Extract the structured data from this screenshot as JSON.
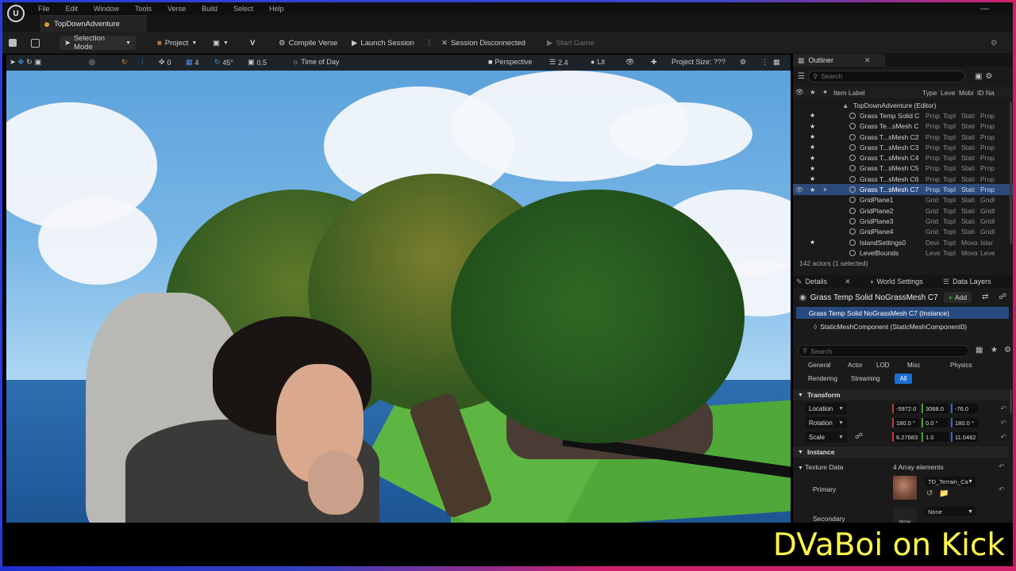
{
  "window": {
    "menu": [
      "File",
      "Edit",
      "Window",
      "Tools",
      "Verse",
      "Build",
      "Select",
      "Help"
    ],
    "project_tab": "TopDownAdventure"
  },
  "toolbar": {
    "selection_mode": "Selection Mode",
    "project": "Project",
    "compile_verse": "Compile Verse",
    "launch_session": "Launch Session",
    "session_status": "Session Disconnected",
    "start_game": "Start Game"
  },
  "viewport": {
    "snap_value": "0",
    "grid_value": "4",
    "angle_value": "45°",
    "scale_value": "0.5",
    "time_of_day": "Time of Day",
    "perspective": "Perspective",
    "camera_speed": "2.4",
    "lit": "Lit",
    "project_size": "Project Size: ???"
  },
  "outliner": {
    "tab_label": "Outliner",
    "search_placeholder": "Search",
    "columns": {
      "label": "Item Label",
      "type": "Type",
      "level": "Leve",
      "mobility": "Mobi",
      "id": "ID Na"
    },
    "root": "TopDownAdventure (Editor)",
    "rows": [
      {
        "label": "Grass Temp Solid C",
        "type": "Prop",
        "level": "TopI",
        "mobility": "Stati",
        "id": "Prop",
        "star": true,
        "selected": false
      },
      {
        "label": "Grass Te...sMesh C",
        "type": "Prop",
        "level": "TopI",
        "mobility": "Stati",
        "id": "Prop",
        "star": true,
        "selected": false
      },
      {
        "label": "Grass T...sMesh C2",
        "type": "Prop",
        "level": "TopI",
        "mobility": "Stati",
        "id": "Prop",
        "star": true,
        "selected": false
      },
      {
        "label": "Grass T...sMesh C3",
        "type": "Prop",
        "level": "TopI",
        "mobility": "Stati",
        "id": "Prop",
        "star": true,
        "selected": false
      },
      {
        "label": "Grass T...sMesh C4",
        "type": "Prop",
        "level": "TopI",
        "mobility": "Stati",
        "id": "Prop",
        "star": true,
        "selected": false
      },
      {
        "label": "Grass T...sMesh C5",
        "type": "Prop",
        "level": "TopI",
        "mobility": "Stati",
        "id": "Prop",
        "star": true,
        "selected": false
      },
      {
        "label": "Grass T...sMesh C6",
        "type": "Prop",
        "level": "TopI",
        "mobility": "Stati",
        "id": "Prop",
        "star": true,
        "selected": false
      },
      {
        "label": "Grass T...sMesh C7",
        "type": "Prop",
        "level": "TopI",
        "mobility": "Stati",
        "id": "Prop",
        "star": true,
        "selected": true
      },
      {
        "label": "GridPlane1",
        "type": "Grid",
        "level": "TopI",
        "mobility": "Stati",
        "id": "GridI",
        "star": false,
        "selected": false
      },
      {
        "label": "GridPlane2",
        "type": "Grid",
        "level": "TopI",
        "mobility": "Stati",
        "id": "GridI",
        "star": false,
        "selected": false
      },
      {
        "label": "GridPlane3",
        "type": "Grid",
        "level": "TopI",
        "mobility": "Stati",
        "id": "GridI",
        "star": false,
        "selected": false
      },
      {
        "label": "GridPlane4",
        "type": "Grid",
        "level": "TopI",
        "mobility": "Stati",
        "id": "GridI",
        "star": false,
        "selected": false
      },
      {
        "label": "IslandSettings0",
        "type": "Devi",
        "level": "TopI",
        "mobility": "Mova",
        "id": "Islar",
        "star": true,
        "selected": false
      },
      {
        "label": "LevelBounds",
        "type": "Leve",
        "level": "TopI",
        "mobility": "Mova",
        "id": "Leve",
        "star": false,
        "selected": false
      }
    ],
    "actor_count": "142 actors (1 selected)"
  },
  "details": {
    "tab_details": "Details",
    "tab_world_settings": "World Settings",
    "tab_data_layers": "Data Layers",
    "object_name": "Grass Temp Solid NoGrassMesh C7",
    "add_label": "Add",
    "instance_row": "Grass Temp Solid NoGrassMesh C7 (Instance)",
    "component_row": "StaticMeshComponent (StaticMeshComponent0)",
    "search_placeholder": "Search",
    "filters": [
      "General",
      "Actor",
      "LOD",
      "Misc",
      "Physics"
    ],
    "filters2": [
      "Rendering",
      "Streaming",
      "All"
    ],
    "transform_header": "Transform",
    "location_label": "Location",
    "location": [
      "-5972.0",
      "3068.0",
      "-76.0"
    ],
    "rotation_label": "Rotation",
    "rotation": [
      "180.0 °",
      "0.0 °",
      "180.0 °"
    ],
    "scale_label": "Scale",
    "scale": [
      "6.27683",
      "1.0",
      "11.0462"
    ],
    "instance_header": "Instance",
    "texture_data_label": "Texture Data",
    "array_elements": "4 Array elements",
    "primary_label": "Primary",
    "primary_value": "TD_Terrain_Ca",
    "secondary_label": "Secondary",
    "secondary_value": "None",
    "none_thumb": "None"
  },
  "overlay": {
    "watermark": "DVaBoi on Kick"
  },
  "colors": {
    "accent_blue": "#1a6fd6",
    "selection": "#2c4a7a",
    "watermark": "#fff84a"
  }
}
